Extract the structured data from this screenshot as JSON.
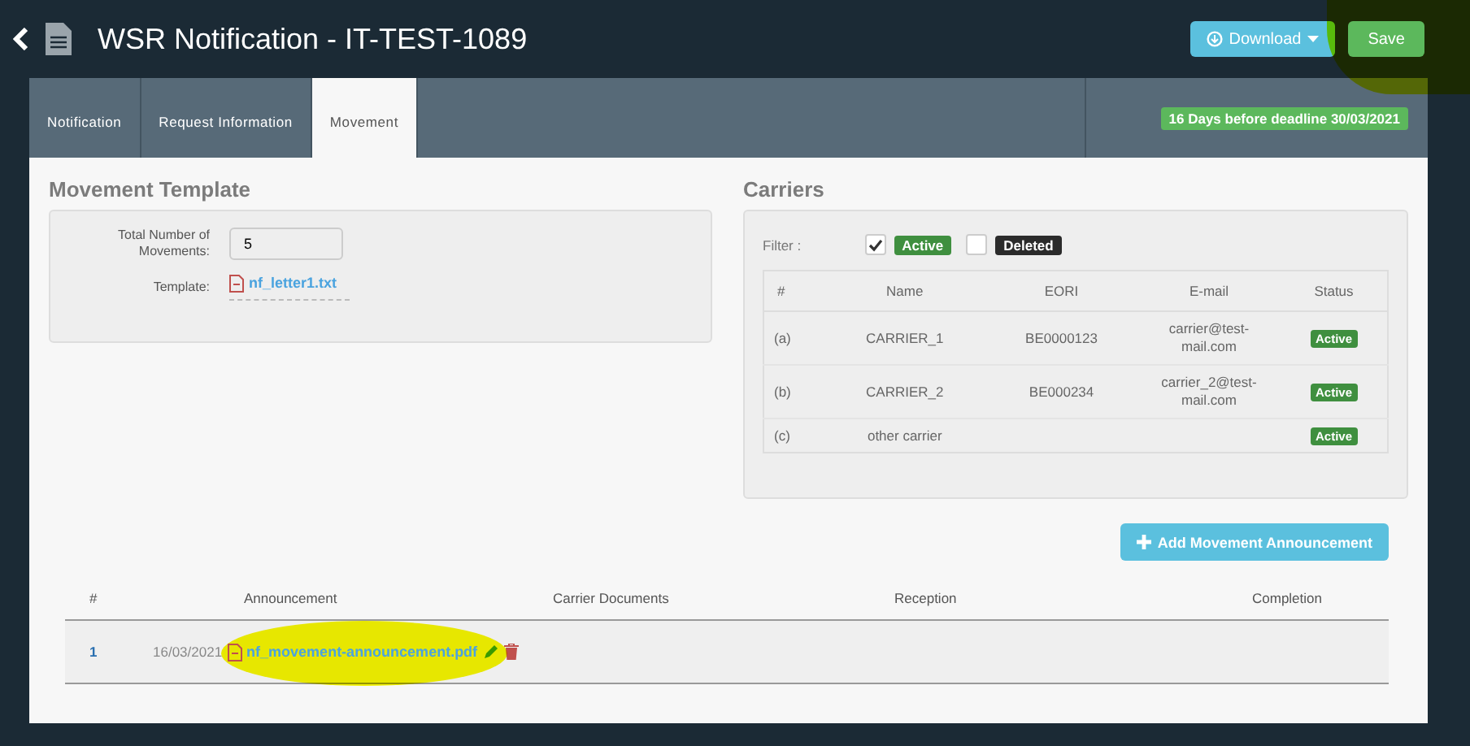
{
  "header": {
    "title": "WSR Notification - IT-TEST-1089",
    "download_button": "Download",
    "save_button": "Save"
  },
  "tabs": [
    {
      "label": "Notification",
      "selected": false
    },
    {
      "label": "Request Information",
      "selected": false
    },
    {
      "label": "Movement",
      "selected": true
    }
  ],
  "deadline_badge": "16 Days before deadline 30/03/2021",
  "movement_template": {
    "title": "Movement Template",
    "fields": [
      {
        "label": "Total Number of Movements:",
        "kind": "input",
        "value": "5"
      },
      {
        "label": "Template:",
        "kind": "file",
        "value": "nf_letter1.txt"
      }
    ]
  },
  "carriers": {
    "title": "Carriers",
    "filter_label": "Filter :",
    "filters": [
      {
        "label": "Active",
        "checked": true,
        "color": "#3f8f3f"
      },
      {
        "label": "Deleted",
        "checked": false,
        "color": "#2b2b2b"
      }
    ],
    "columns": [
      "#",
      "Name",
      "EORI",
      "E-mail",
      "Status"
    ],
    "rows": [
      {
        "index": "(a)",
        "name": "CARRIER_1",
        "eori": "BE0000123",
        "email": "carrier@test-mail.com",
        "status": "Active"
      },
      {
        "index": "(b)",
        "name": "CARRIER_2",
        "eori": "BE000234",
        "email": "carrier_2@test-mail.com",
        "status": "Active"
      },
      {
        "index": "(c)",
        "name": "other carrier",
        "eori": "",
        "email": "",
        "status": "Active"
      }
    ]
  },
  "announcements": {
    "add_button": "Add Movement Announcement",
    "columns": [
      "#",
      "Announcement",
      "Carrier Documents",
      "Reception",
      "Completion"
    ],
    "rows": [
      {
        "number": "1",
        "date": "16/03/2021",
        "file": "nf_movement-announcement.pdf"
      }
    ]
  }
}
